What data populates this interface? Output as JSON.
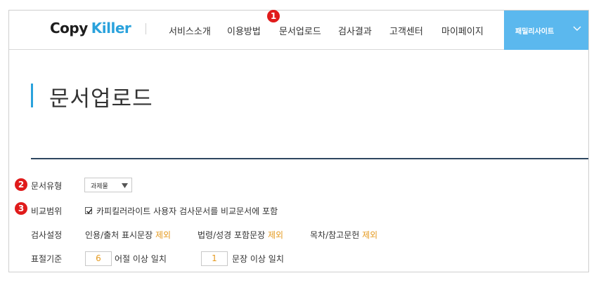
{
  "header": {
    "logo_copy": "Copy",
    "logo_killer": "Killer",
    "nav": [
      "서비스소개",
      "이용방법",
      "문서업로드",
      "검사결과",
      "고객센터",
      "마이페이지"
    ],
    "family_site": "패밀리사이트"
  },
  "page": {
    "title": "문서업로드"
  },
  "badges": [
    "1",
    "2",
    "3"
  ],
  "form": {
    "doc_type": {
      "label": "문서유형",
      "value": "과제물"
    },
    "compare": {
      "label": "비교범위",
      "checkbox_text": "카피킬러라이트 사용자 검사문서를 비교문서에 포함",
      "checked": true
    },
    "settings": {
      "label": "검사설정",
      "opt1": "인용/출처 표시문장",
      "opt1_action": "제외",
      "opt2": "법령/성경 포함문장",
      "opt2_action": "제외",
      "opt3": "목차/참고문헌",
      "opt3_action": "제외"
    },
    "criteria": {
      "label": "표절기준",
      "word_count": "6",
      "word_suffix": "어절 이상 일치",
      "sentence_count": "1",
      "sentence_suffix": "문장 이상 일치"
    }
  },
  "colors": {
    "accent": "#2aa2dc",
    "family_bg": "#5bb8ee",
    "orange": "#e59a1f",
    "badge": "#e01b1b",
    "rule": "#2e4760"
  }
}
